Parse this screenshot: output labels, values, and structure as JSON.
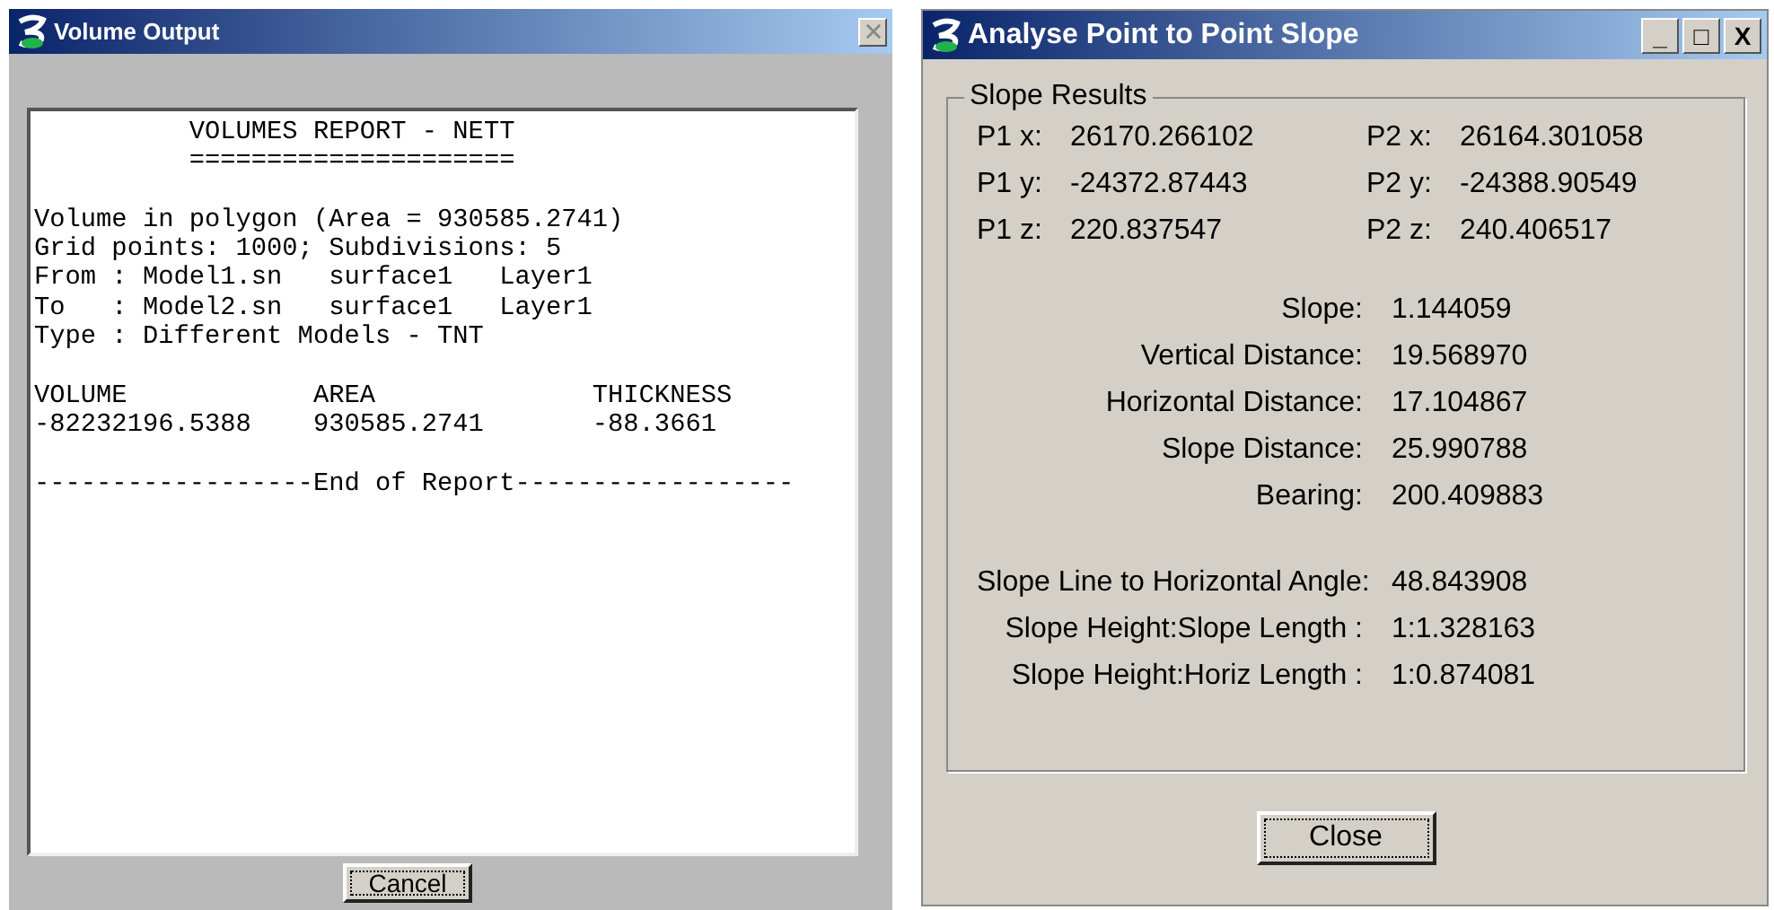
{
  "volume_window": {
    "title": "Volume Output",
    "close_disabled": true,
    "report": {
      "heading": [
        "          VOLUMES REPORT - NETT",
        "          ====================="
      ],
      "paragraphs": [
        [
          "Volume in polygon (Area = 930585.2741)",
          "Grid points: 1000; Subdivisions: 5",
          "From : Model1.sn   surface1   Layer1",
          "To   : Model2.sn   surface1   Layer1",
          "Type : Different Models - TNT"
        ],
        [
          "VOLUME            AREA              THICKNESS",
          "-82232196.5388    930585.2741       -88.3661"
        ],
        [
          "------------------End of Report------------------"
        ]
      ]
    },
    "button": "Cancel"
  },
  "slope_window": {
    "title": "Analyse Point to Point Slope",
    "controls": [
      "_",
      "□",
      "X"
    ],
    "group_title": "Slope Results",
    "points": [
      {
        "label1": "P1 x:",
        "value1": "26170.266102",
        "label2": "P2 x:",
        "value2": "26164.301058"
      },
      {
        "label1": "P1 y:",
        "value1": "-24372.87443",
        "label2": "P2 y:",
        "value2": "-24388.90549"
      },
      {
        "label1": "P1 z:",
        "value1": "220.837547",
        "label2": "P2 z:",
        "value2": "240.406517"
      }
    ],
    "results": [
      [
        {
          "label": "Slope:",
          "value": "1.144059"
        },
        {
          "label": "Vertical Distance:",
          "value": "19.568970"
        },
        {
          "label": "Horizontal Distance:",
          "value": "17.104867"
        },
        {
          "label": "Slope Distance:",
          "value": "25.990788"
        },
        {
          "label": "Bearing:",
          "value": "200.409883"
        }
      ],
      [
        {
          "label": "Slope Line to Horizontal Angle:",
          "value": "48.843908"
        },
        {
          "label": "Slope Height:Slope Length :",
          "value": "1:1.328163"
        },
        {
          "label": "Slope Height:Horiz Length :",
          "value": "1:0.874081"
        }
      ]
    ],
    "button": "Close"
  }
}
